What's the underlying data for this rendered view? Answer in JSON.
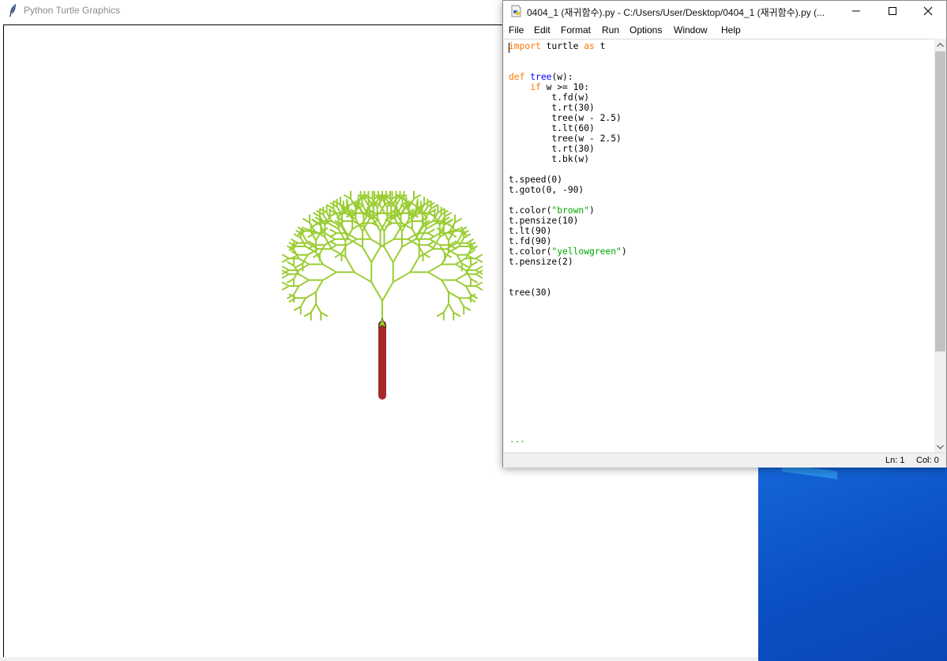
{
  "turtle_window": {
    "title": "Python Turtle Graphics",
    "drawing": {
      "trunk_color": "brown",
      "trunk_pensize": 10,
      "branch_color": "yellowgreen",
      "branch_pensize": 2,
      "start": [
        0,
        -90
      ],
      "trunk_length": 90,
      "tree_width": 30,
      "min_width": 10,
      "width_step": 2.5,
      "angle": 30
    }
  },
  "editor": {
    "title": "0404_1 (재귀함수).py - C:/Users/User/Desktop/0404_1 (재귀함수).py (...",
    "menu": [
      "File",
      "Edit",
      "Format",
      "Run",
      "Options",
      "Window",
      "Help"
    ],
    "code_lines": [
      [
        {
          "t": "import",
          "c": "kw"
        },
        {
          "t": " turtle ",
          "c": "plain"
        },
        {
          "t": "as",
          "c": "kw"
        },
        {
          "t": " t",
          "c": "plain"
        }
      ],
      [],
      [],
      [
        {
          "t": "def",
          "c": "kw"
        },
        {
          "t": " ",
          "c": "plain"
        },
        {
          "t": "tree",
          "c": "def"
        },
        {
          "t": "(w):",
          "c": "plain"
        }
      ],
      [
        {
          "t": "    ",
          "c": "plain"
        },
        {
          "t": "if",
          "c": "kw"
        },
        {
          "t": " w >= 10:",
          "c": "plain"
        }
      ],
      [
        {
          "t": "        t.fd(w)",
          "c": "plain"
        }
      ],
      [
        {
          "t": "        t.rt(30)",
          "c": "plain"
        }
      ],
      [
        {
          "t": "        tree(w - 2.5)",
          "c": "plain"
        }
      ],
      [
        {
          "t": "        t.lt(60)",
          "c": "plain"
        }
      ],
      [
        {
          "t": "        tree(w - 2.5)",
          "c": "plain"
        }
      ],
      [
        {
          "t": "        t.rt(30)",
          "c": "plain"
        }
      ],
      [
        {
          "t": "        t.bk(w)",
          "c": "plain"
        }
      ],
      [],
      [
        {
          "t": "t.speed(0)",
          "c": "plain"
        }
      ],
      [
        {
          "t": "t.goto(0, -90)",
          "c": "plain"
        }
      ],
      [],
      [
        {
          "t": "t.color(",
          "c": "plain"
        },
        {
          "t": "\"brown\"",
          "c": "str"
        },
        {
          "t": ")",
          "c": "plain"
        }
      ],
      [
        {
          "t": "t.pensize(10)",
          "c": "plain"
        }
      ],
      [
        {
          "t": "t.lt(90)",
          "c": "plain"
        }
      ],
      [
        {
          "t": "t.fd(90)",
          "c": "plain"
        }
      ],
      [
        {
          "t": "t.color(",
          "c": "plain"
        },
        {
          "t": "\"yellowgreen\"",
          "c": "str"
        },
        {
          "t": ")",
          "c": "plain"
        }
      ],
      [
        {
          "t": "t.pensize(2)",
          "c": "plain"
        }
      ],
      [],
      [],
      [
        {
          "t": "tree(30)",
          "c": "plain"
        }
      ]
    ],
    "ellipsis": "...",
    "status": {
      "ln": "Ln: 1",
      "col": "Col: 0"
    },
    "colors": {
      "kw": "#ff7700",
      "def": "#0000ff",
      "str": "#00aa00",
      "plain": "#000000"
    }
  }
}
